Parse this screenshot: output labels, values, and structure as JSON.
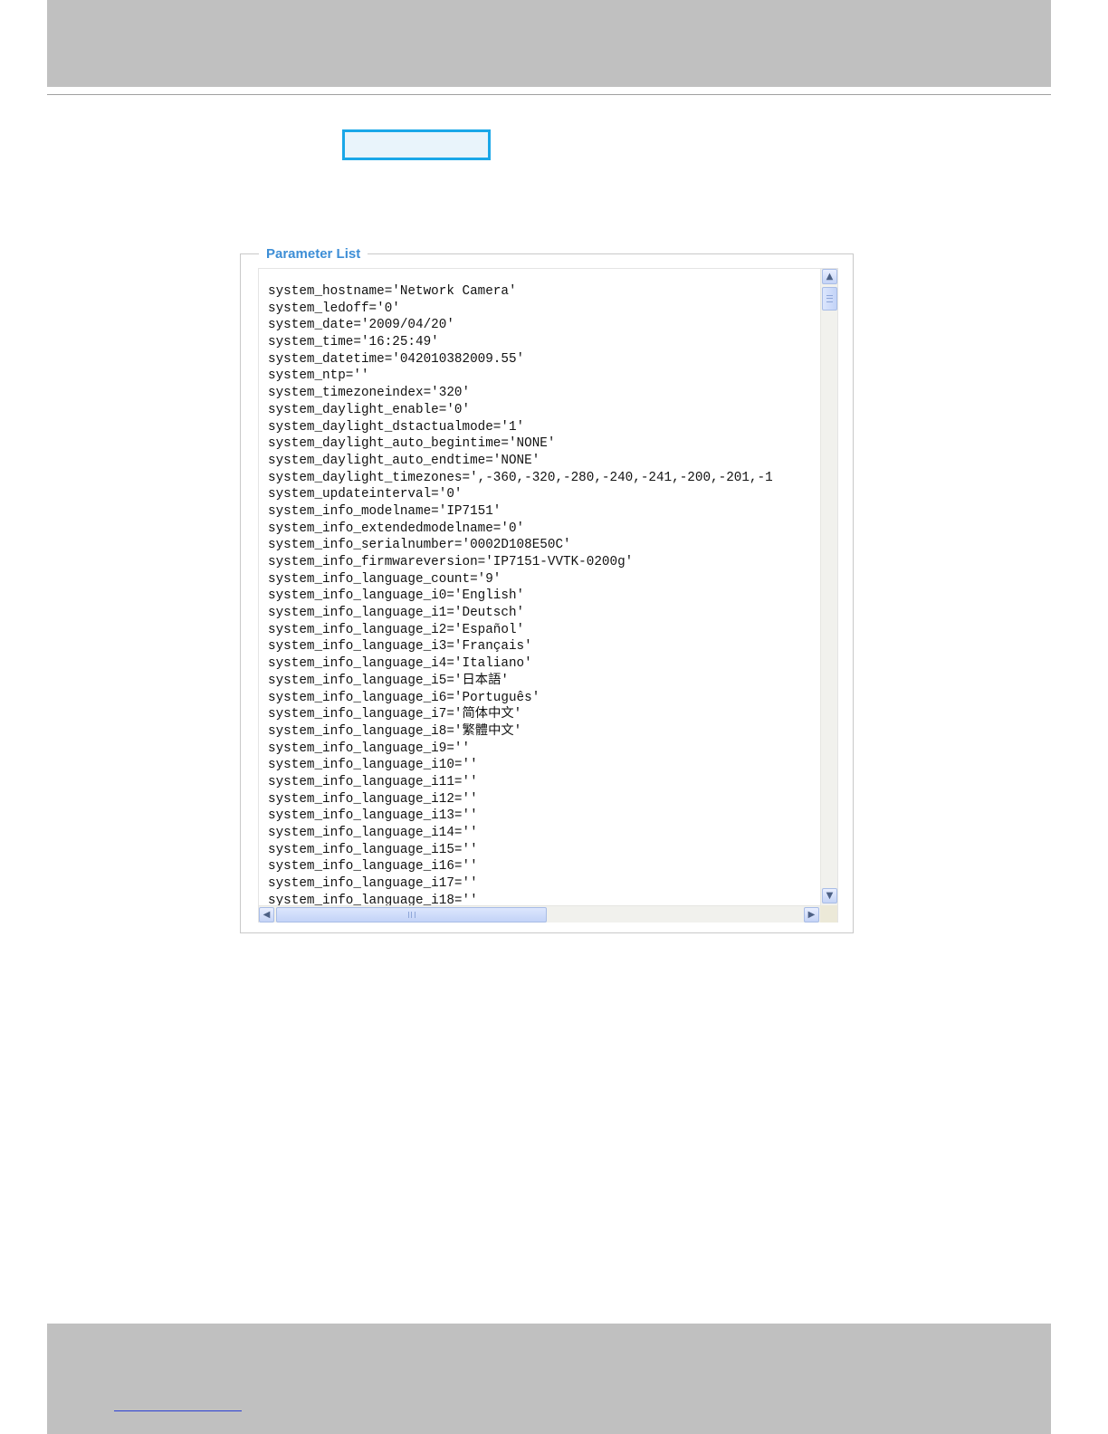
{
  "parameter_list": {
    "legend": "Parameter List",
    "lines": [
      "system_hostname='Network Camera'",
      "system_ledoff='0'",
      "system_date='2009/04/20'",
      "system_time='16:25:49'",
      "system_datetime='042010382009.55'",
      "system_ntp=''",
      "system_timezoneindex='320'",
      "system_daylight_enable='0'",
      "system_daylight_dstactualmode='1'",
      "system_daylight_auto_begintime='NONE'",
      "system_daylight_auto_endtime='NONE'",
      "system_daylight_timezones=',-360,-320,-280,-240,-241,-200,-201,-1",
      "system_updateinterval='0'",
      "system_info_modelname='IP7151'",
      "system_info_extendedmodelname='0'",
      "system_info_serialnumber='0002D108E50C'",
      "system_info_firmwareversion='IP7151-VVTK-0200g'",
      "system_info_language_count='9'",
      "system_info_language_i0='English'",
      "system_info_language_i1='Deutsch'",
      "system_info_language_i2='Español'",
      "system_info_language_i3='Français'",
      "system_info_language_i4='Italiano'",
      "system_info_language_i5='日本語'",
      "system_info_language_i6='Português'",
      "system_info_language_i7='简体中文'",
      "system_info_language_i8='繁體中文'",
      "system_info_language_i9=''",
      "system_info_language_i10=''",
      "system_info_language_i11=''",
      "system_info_language_i12=''",
      "system_info_language_i13=''",
      "system_info_language_i14=''",
      "system_info_language_i15=''",
      "system_info_language_i16=''",
      "system_info_language_i17=''",
      "system_info_language_i18=''"
    ]
  },
  "scrollbars": {
    "vertical_position": 0,
    "horizontal_position": 0
  },
  "colors": {
    "legend_text": "#3d8ed6",
    "highlight_border": "#1aa7e8",
    "header_footer_band": "#c0c0c0"
  }
}
